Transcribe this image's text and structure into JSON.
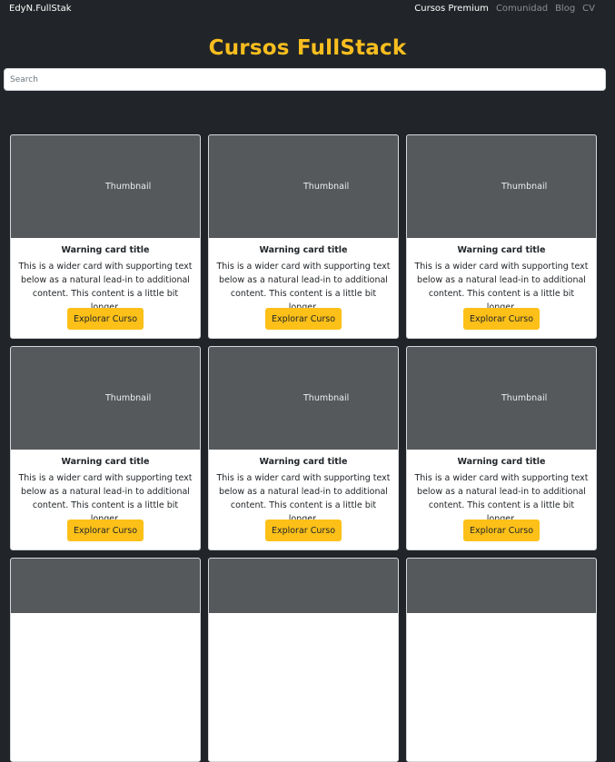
{
  "navbar": {
    "brand": "EdyN.FullStak",
    "links": [
      {
        "label": "Cursos Premium",
        "active": true
      },
      {
        "label": "Comunidad",
        "active": false
      },
      {
        "label": "Blog",
        "active": false
      },
      {
        "label": "CV",
        "active": false
      }
    ]
  },
  "page": {
    "title": "Cursos FullStack"
  },
  "search": {
    "placeholder": "Search",
    "value": ""
  },
  "cards": [
    {
      "thumbnail": "Thumbnail",
      "title": "Warning card title",
      "text": "This is a wider card with supporting text below as a natural lead-in to additional content. This content is a little bit longer.",
      "button": "Explorar Curso"
    },
    {
      "thumbnail": "Thumbnail",
      "title": "Warning card title",
      "text": "This is a wider card with supporting text below as a natural lead-in to additional content. This content is a little bit longer.",
      "button": "Explorar Curso"
    },
    {
      "thumbnail": "Thumbnail",
      "title": "Warning card title",
      "text": "This is a wider card with supporting text below as a natural lead-in to additional content. This content is a little bit longer.",
      "button": "Explorar Curso"
    },
    {
      "thumbnail": "Thumbnail",
      "title": "Warning card title",
      "text": "This is a wider card with supporting text below as a natural lead-in to additional content. This content is a little bit longer.",
      "button": "Explorar Curso"
    },
    {
      "thumbnail": "Thumbnail",
      "title": "Warning card title",
      "text": "This is a wider card with supporting text below as a natural lead-in to additional content. This content is a little bit longer.",
      "button": "Explorar Curso"
    },
    {
      "thumbnail": "Thumbnail",
      "title": "Warning card title",
      "text": "This is a wider card with supporting text below as a natural lead-in to additional content. This content is a little bit longer.",
      "button": "Explorar Curso"
    }
  ],
  "colors": {
    "background": "#212529",
    "title": "#f8be1f",
    "button": "#fcc018",
    "thumbnail": "#55595c"
  }
}
